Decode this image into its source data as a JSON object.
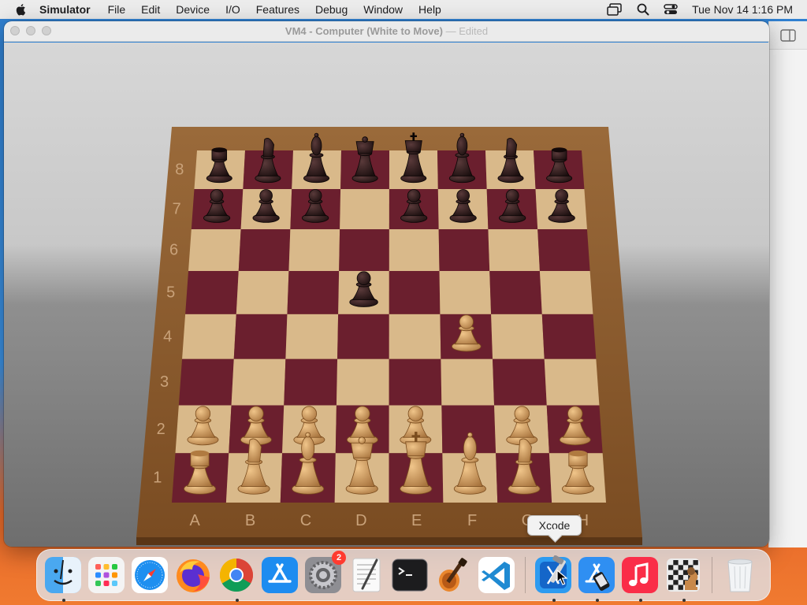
{
  "menubar": {
    "app_name": "Simulator",
    "items": [
      "File",
      "Edit",
      "Device",
      "I/O",
      "Features",
      "Debug",
      "Window",
      "Help"
    ],
    "clock": "Tue Nov 14  1:16 PM",
    "icons": [
      "apple-icon",
      "display-icon",
      "search-icon",
      "control-center-icon"
    ]
  },
  "window": {
    "title": "VM4 - Computer  (White to Move)",
    "edited": " — Edited"
  },
  "board": {
    "ranks": [
      "8",
      "7",
      "6",
      "5",
      "4",
      "3",
      "2",
      "1"
    ],
    "files": [
      "A",
      "B",
      "C",
      "D",
      "E",
      "F",
      "G",
      "H"
    ],
    "colors": {
      "dark_square": "#6b1f2e",
      "light_square": "#d9b98a",
      "frame": "#8a5a2e",
      "white_piece": "#d8a86a",
      "black_piece": "#2a1a1a"
    },
    "position": {
      "8": [
        "r",
        "n",
        "b",
        "q",
        "k",
        "b",
        "n",
        "r"
      ],
      "7": [
        "p",
        "p",
        "p",
        "",
        "p",
        "p",
        "p",
        "p"
      ],
      "6": [
        "",
        "",
        "",
        "",
        "",
        "",
        "",
        ""
      ],
      "5": [
        "",
        "",
        "",
        "p",
        "",
        "",
        "",
        ""
      ],
      "4": [
        "",
        "",
        "",
        "",
        "",
        "P",
        "",
        ""
      ],
      "3": [
        "",
        "",
        "",
        "",
        "",
        "",
        "",
        ""
      ],
      "2": [
        "P",
        "P",
        "P",
        "P",
        "P",
        "",
        "P",
        "P"
      ],
      "1": [
        "R",
        "N",
        "B",
        "Q",
        "K",
        "B",
        "N",
        "R"
      ]
    }
  },
  "tooltip": "Xcode",
  "dock": {
    "items": [
      {
        "name": "finder",
        "icon": "finder-icon",
        "running": true
      },
      {
        "name": "launchpad",
        "icon": "launchpad-icon",
        "running": false
      },
      {
        "name": "safari",
        "icon": "safari-icon",
        "running": false
      },
      {
        "name": "firefox",
        "icon": "firefox-icon",
        "running": false
      },
      {
        "name": "chrome",
        "icon": "chrome-icon",
        "running": true
      },
      {
        "name": "app-store",
        "icon": "app-store-icon",
        "running": false
      },
      {
        "name": "system-settings",
        "icon": "system-settings-icon",
        "running": false,
        "badge": "2"
      },
      {
        "name": "textedit",
        "icon": "textedit-icon",
        "running": false
      },
      {
        "name": "terminal",
        "icon": "terminal-icon",
        "running": false
      },
      {
        "name": "garageband",
        "icon": "garageband-icon",
        "running": false
      },
      {
        "name": "vscode",
        "icon": "vscode-icon",
        "running": false
      },
      {
        "name": "xcode",
        "icon": "xcode-icon",
        "running": true
      },
      {
        "name": "simulator",
        "icon": "simulator-icon",
        "running": true
      },
      {
        "name": "music",
        "icon": "music-icon",
        "running": true
      },
      {
        "name": "chess",
        "icon": "chess-icon",
        "running": true
      },
      {
        "name": "trash",
        "icon": "trash-icon",
        "running": false
      }
    ]
  }
}
